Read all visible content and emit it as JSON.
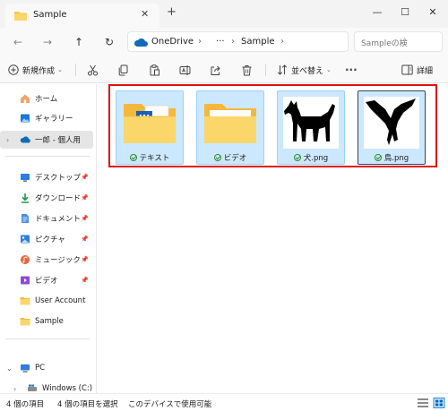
{
  "window": {
    "tab_title": "Sample",
    "new_tab_label": "+",
    "minimize_label": "—",
    "maximize_label": "☐",
    "close_label": "✕"
  },
  "nav": {
    "back_label": "←",
    "forward_label": "→",
    "up_label": "↑",
    "refresh_label": "↻",
    "breadcrumb": [
      "OneDrive",
      "···",
      "Sample"
    ],
    "breadcrumb_sep": "›",
    "search_placeholder": "Sampleの検"
  },
  "commands": {
    "new_label": "新規作成",
    "sort_label": "並べ替え",
    "more_label": "···",
    "details_label": "詳細"
  },
  "sidebar": {
    "items": [
      {
        "label": "ホーム",
        "icon": "home-icon"
      },
      {
        "label": "ギャラリー",
        "icon": "gallery-icon"
      },
      {
        "label": "一郎 - 個人用",
        "icon": "cloud-icon"
      },
      {
        "label": "デスクトップ",
        "icon": "desktop-icon"
      },
      {
        "label": "ダウンロード",
        "icon": "download-icon"
      },
      {
        "label": "ドキュメント",
        "icon": "document-icon"
      },
      {
        "label": "ピクチャ",
        "icon": "picture-icon"
      },
      {
        "label": "ミュージック",
        "icon": "music-icon"
      },
      {
        "label": "ビデオ",
        "icon": "video-icon"
      },
      {
        "label": "User Account",
        "icon": "folder-icon"
      },
      {
        "label": "Sample",
        "icon": "folder-icon"
      },
      {
        "label": "PC",
        "icon": "pc-icon"
      },
      {
        "label": "Windows (C:)",
        "icon": "drive-icon"
      }
    ]
  },
  "files": [
    {
      "name": "テキスト",
      "icon": "folder-word-icon"
    },
    {
      "name": "ビデオ",
      "icon": "folder-icon"
    },
    {
      "name": "犬.png",
      "icon": "dog-image"
    },
    {
      "name": "鳥.png",
      "icon": "bird-image"
    }
  ],
  "status": {
    "item_count": "4 個の項目",
    "selected_count": "4 個の項目を選択",
    "availability": "このデバイスで使用可能"
  },
  "colors": {
    "selection_bg": "#cce8ff",
    "selection_border": "#99d1ff",
    "highlight": "#e01010",
    "folder": "#f8c74a",
    "accent": "#0067c0"
  }
}
